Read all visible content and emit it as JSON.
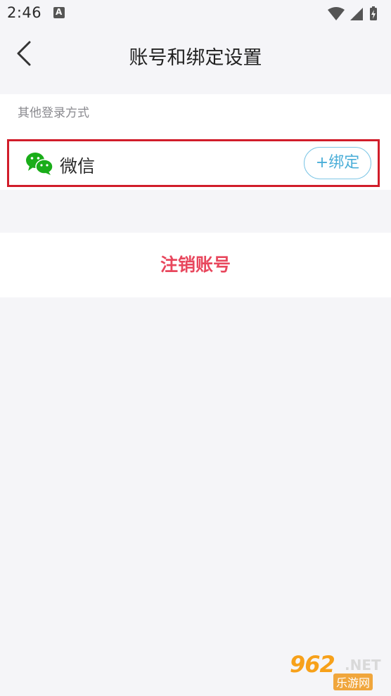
{
  "status_bar": {
    "time": "2:46"
  },
  "header": {
    "title": "账号和绑定设置"
  },
  "login_methods": {
    "section_label": "其他登录方式",
    "items": [
      {
        "name": "微信",
        "icon": "wechat-icon",
        "action_label": "+绑定"
      }
    ]
  },
  "account": {
    "cancel_label": "注销账号"
  },
  "watermark": {
    "number": "962",
    "suffix": ".NET",
    "cn": "乐游网"
  },
  "colors": {
    "background": "#f5f5f8",
    "cancel_text": "#e8475d",
    "bind_accent": "#4aaed8",
    "highlight_border": "#d11d2a",
    "wechat_green": "#1aad19"
  }
}
